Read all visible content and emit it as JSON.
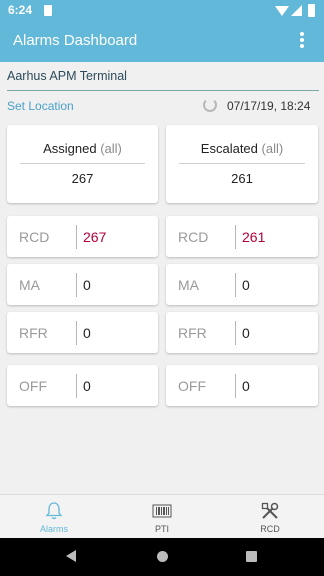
{
  "status_bar": {
    "time": "6:24"
  },
  "app_bar": {
    "title": "Alarms Dashboard"
  },
  "terminal": {
    "name": "Aarhus APM Terminal"
  },
  "location": {
    "set_label": "Set Location",
    "datetime": "07/17/19, 18:24"
  },
  "summary": {
    "assigned": {
      "label": "Assigned",
      "qualifier": "(all)",
      "value": "267"
    },
    "escalated": {
      "label": "Escalated",
      "qualifier": "(all)",
      "value": "261"
    }
  },
  "assigned_metrics": [
    {
      "label": "RCD",
      "value": "267"
    },
    {
      "label": "MA",
      "value": "0"
    },
    {
      "label": "RFR",
      "value": "0"
    },
    {
      "label": "OFF",
      "value": "0"
    }
  ],
  "escalated_metrics": [
    {
      "label": "RCD",
      "value": "261"
    },
    {
      "label": "MA",
      "value": "0"
    },
    {
      "label": "RFR",
      "value": "0"
    },
    {
      "label": "OFF",
      "value": "0"
    }
  ],
  "bottom_nav": [
    {
      "label": "Alarms",
      "icon": "bell-icon",
      "active": true
    },
    {
      "label": "PTI",
      "icon": "barcode-icon",
      "active": false
    },
    {
      "label": "RCD",
      "icon": "tools-icon",
      "active": false
    }
  ],
  "colors": {
    "accent": "#62b8d8",
    "alert_value": "#b0003c"
  }
}
